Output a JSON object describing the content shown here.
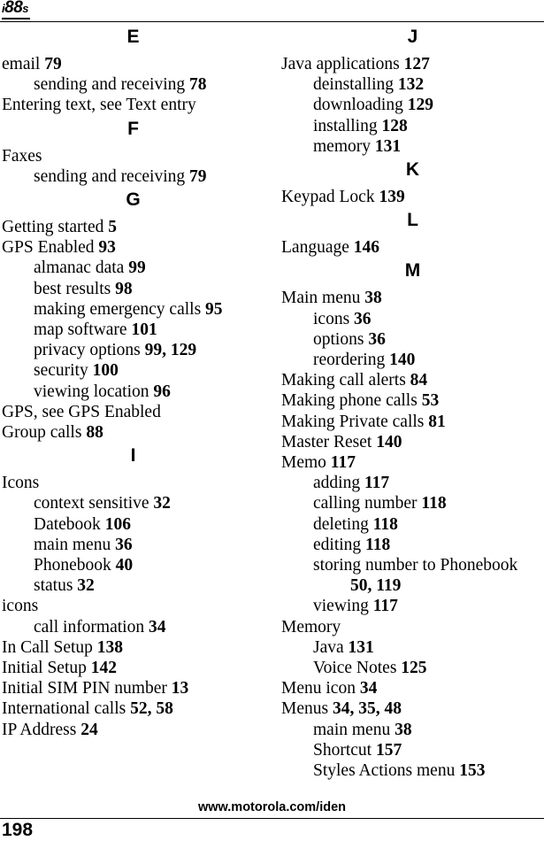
{
  "header": {
    "logo_prefix": "i",
    "logo_main": "88",
    "logo_suffix": "s"
  },
  "footer": {
    "url": "www.motorola.com/iden",
    "page_number": "198"
  },
  "columns": [
    {
      "id": "left",
      "blocks": [
        {
          "type": "entry",
          "level": "main",
          "text": "email",
          "pages": "79"
        },
        {
          "type": "entry",
          "level": "sub",
          "text": "sending and receiving",
          "pages": "78"
        },
        {
          "type": "entry",
          "level": "main",
          "text": "Entering text, see Text entry",
          "pages": ""
        },
        {
          "type": "letter",
          "text": "F"
        },
        {
          "type": "entry",
          "level": "main",
          "text": "Faxes",
          "pages": ""
        },
        {
          "type": "entry",
          "level": "sub",
          "text": "sending and receiving",
          "pages": "79"
        },
        {
          "type": "letter",
          "text": "G"
        },
        {
          "type": "entry",
          "level": "main",
          "text": "Getting started",
          "pages": "5"
        },
        {
          "type": "entry",
          "level": "main",
          "text": "GPS Enabled",
          "pages": "93"
        },
        {
          "type": "entry",
          "level": "sub",
          "text": "almanac data",
          "pages": "99"
        },
        {
          "type": "entry",
          "level": "sub",
          "text": "best results",
          "pages": "98"
        },
        {
          "type": "entry",
          "level": "sub",
          "text": "making emergency calls",
          "pages": "95"
        },
        {
          "type": "entry",
          "level": "sub",
          "text": "map software",
          "pages": "101"
        },
        {
          "type": "entry",
          "level": "sub",
          "text": "privacy options",
          "pages": "99, 129"
        },
        {
          "type": "entry",
          "level": "sub",
          "text": "security",
          "pages": "100"
        },
        {
          "type": "entry",
          "level": "sub",
          "text": "viewing location",
          "pages": "96"
        },
        {
          "type": "entry",
          "level": "main",
          "text": "GPS, see GPS Enabled",
          "pages": ""
        },
        {
          "type": "entry",
          "level": "main",
          "text": "Group calls",
          "pages": "88"
        },
        {
          "type": "letter",
          "text": "I"
        },
        {
          "type": "entry",
          "level": "main",
          "text": "Icons",
          "pages": ""
        },
        {
          "type": "entry",
          "level": "sub",
          "text": "context sensitive",
          "pages": "32"
        },
        {
          "type": "entry",
          "level": "sub",
          "text": "Datebook",
          "pages": "106"
        },
        {
          "type": "entry",
          "level": "sub",
          "text": "main menu",
          "pages": "36"
        },
        {
          "type": "entry",
          "level": "sub",
          "text": "Phonebook",
          "pages": "40"
        },
        {
          "type": "entry",
          "level": "sub",
          "text": "status",
          "pages": "32"
        },
        {
          "type": "entry",
          "level": "main",
          "text": "icons",
          "pages": ""
        },
        {
          "type": "entry",
          "level": "sub",
          "text": "call information",
          "pages": "34"
        },
        {
          "type": "entry",
          "level": "main",
          "text": "In Call Setup",
          "pages": "138"
        },
        {
          "type": "entry",
          "level": "main",
          "text": "Initial Setup",
          "pages": "142"
        },
        {
          "type": "entry",
          "level": "main",
          "text": "Initial SIM PIN number",
          "pages": "13"
        },
        {
          "type": "entry",
          "level": "main",
          "text": "International calls",
          "pages": "52, 58"
        },
        {
          "type": "entry",
          "level": "main",
          "text": "IP Address",
          "pages": "24"
        }
      ]
    },
    {
      "id": "right",
      "blocks": [
        {
          "type": "entry",
          "level": "main",
          "text": "Java applications",
          "pages": "127"
        },
        {
          "type": "entry",
          "level": "sub",
          "text": "deinstalling",
          "pages": "132"
        },
        {
          "type": "entry",
          "level": "sub",
          "text": "downloading",
          "pages": "129"
        },
        {
          "type": "entry",
          "level": "sub",
          "text": "installing",
          "pages": "128"
        },
        {
          "type": "entry",
          "level": "sub",
          "text": "memory",
          "pages": "131"
        },
        {
          "type": "letter",
          "text": "K"
        },
        {
          "type": "entry",
          "level": "main",
          "text": "Keypad Lock",
          "pages": "139"
        },
        {
          "type": "letter",
          "text": "L"
        },
        {
          "type": "entry",
          "level": "main",
          "text": "Language",
          "pages": "146"
        },
        {
          "type": "letter",
          "text": "M"
        },
        {
          "type": "entry",
          "level": "main",
          "text": "Main menu",
          "pages": "38"
        },
        {
          "type": "entry",
          "level": "sub",
          "text": "icons",
          "pages": "36"
        },
        {
          "type": "entry",
          "level": "sub",
          "text": "options",
          "pages": "36"
        },
        {
          "type": "entry",
          "level": "sub",
          "text": "reordering",
          "pages": "140"
        },
        {
          "type": "entry",
          "level": "main",
          "text": "Making call alerts",
          "pages": "84"
        },
        {
          "type": "entry",
          "level": "main",
          "text": "Making phone calls",
          "pages": "53"
        },
        {
          "type": "entry",
          "level": "main",
          "text": "Making Private calls",
          "pages": "81"
        },
        {
          "type": "entry",
          "level": "main",
          "text": "Master Reset",
          "pages": "140"
        },
        {
          "type": "entry",
          "level": "main",
          "text": "Memo",
          "pages": "117"
        },
        {
          "type": "entry",
          "level": "sub",
          "text": "adding",
          "pages": "117"
        },
        {
          "type": "entry",
          "level": "sub",
          "text": "calling number",
          "pages": "118"
        },
        {
          "type": "entry",
          "level": "sub",
          "text": "deleting",
          "pages": "118"
        },
        {
          "type": "entry",
          "level": "sub",
          "text": "editing",
          "pages": "118"
        },
        {
          "type": "entry",
          "level": "sub",
          "text": "storing number to Phonebook",
          "pages": ""
        },
        {
          "type": "entry",
          "level": "cont",
          "text": "",
          "pages": "50, 119"
        },
        {
          "type": "entry",
          "level": "sub",
          "text": "viewing",
          "pages": "117"
        },
        {
          "type": "entry",
          "level": "main",
          "text": "Memory",
          "pages": ""
        },
        {
          "type": "entry",
          "level": "sub",
          "text": "Java",
          "pages": "131"
        },
        {
          "type": "entry",
          "level": "sub",
          "text": "Voice Notes",
          "pages": "125"
        },
        {
          "type": "entry",
          "level": "main",
          "text": "Menu icon",
          "pages": "34"
        },
        {
          "type": "entry",
          "level": "main",
          "text": "Menus",
          "pages": "34, 35, 48"
        },
        {
          "type": "entry",
          "level": "sub",
          "text": "main menu",
          "pages": "38"
        },
        {
          "type": "entry",
          "level": "sub",
          "text": "Shortcut",
          "pages": "157"
        },
        {
          "type": "entry",
          "level": "sub",
          "text": "Styles Actions menu",
          "pages": "153"
        }
      ]
    }
  ],
  "first_letters": {
    "left": "E",
    "right": "J"
  }
}
